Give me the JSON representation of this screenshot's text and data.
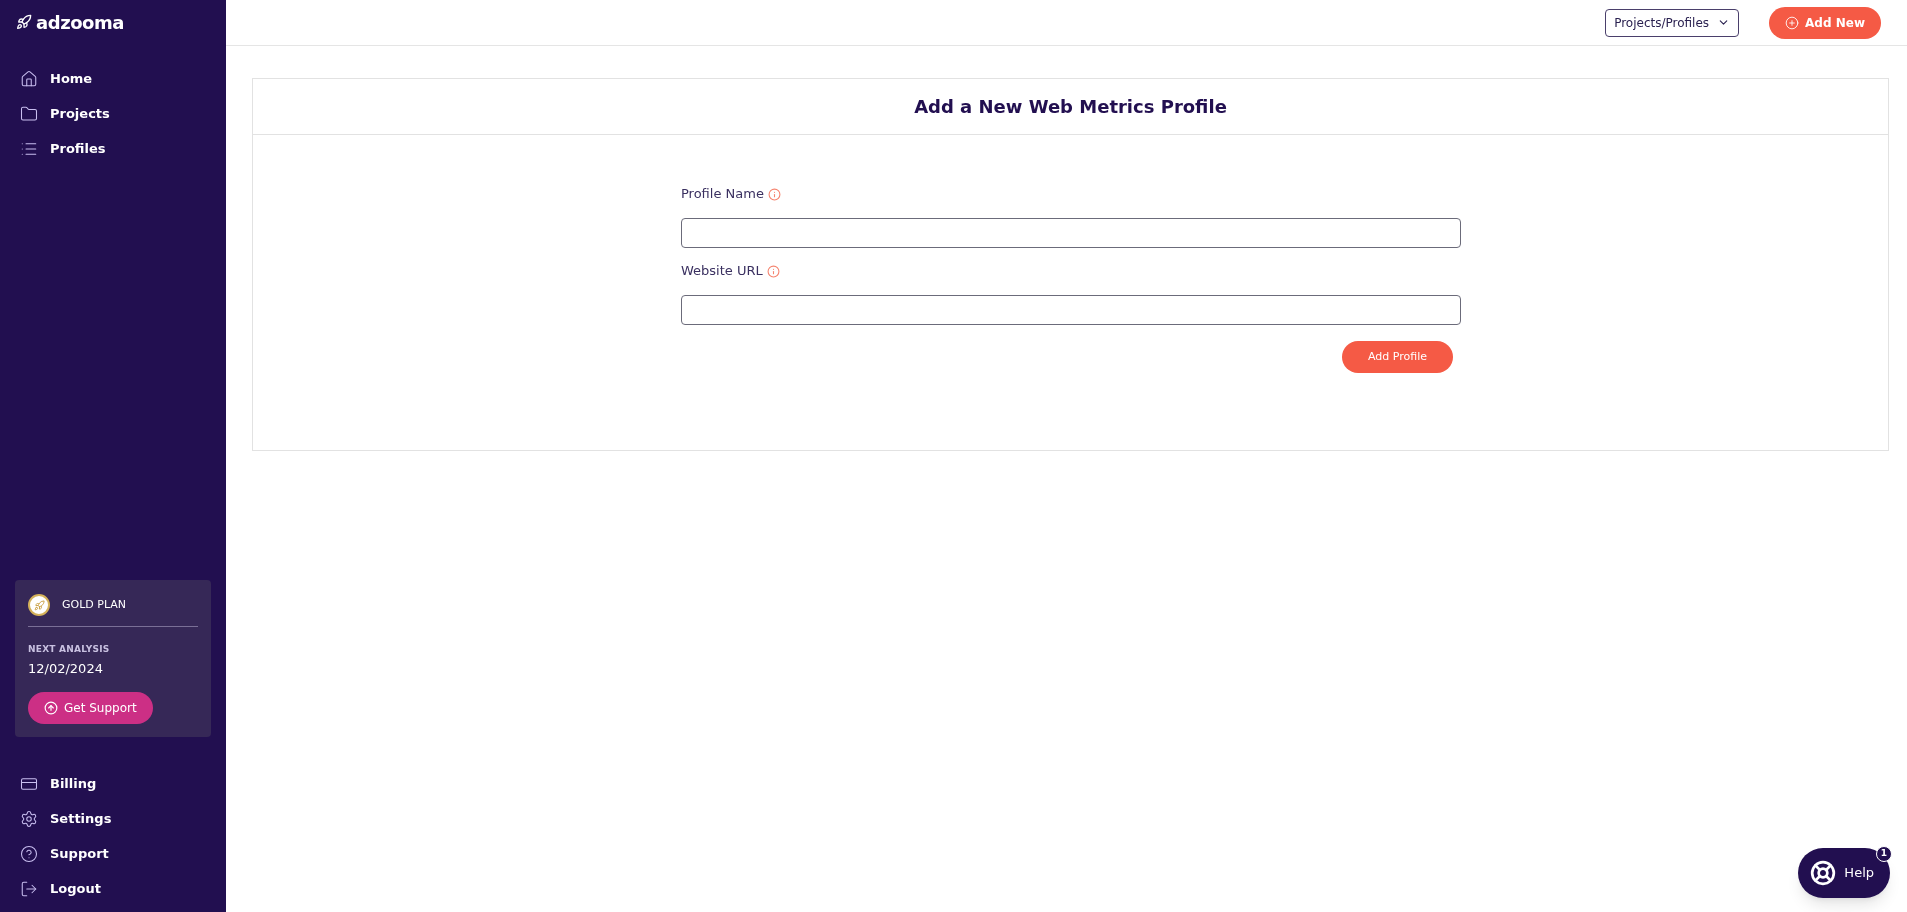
{
  "logo": "adzooma",
  "nav_top": [
    {
      "kind": "home",
      "label": "Home"
    },
    {
      "kind": "projects",
      "label": "Projects"
    },
    {
      "kind": "profiles",
      "label": "Profiles"
    }
  ],
  "plan": {
    "name": "GOLD PLAN",
    "next_label": "NEXT ANALYSIS",
    "next_date": "12/02/2024",
    "button": "Get Support"
  },
  "nav_bottom": [
    {
      "kind": "billing",
      "label": "Billing"
    },
    {
      "kind": "settings",
      "label": "Settings"
    },
    {
      "kind": "support",
      "label": "Support"
    },
    {
      "kind": "logout",
      "label": "Logout"
    }
  ],
  "header": {
    "dropdown": "Projects/Profiles",
    "add_button": "Add New"
  },
  "form": {
    "title": "Add a New Web Metrics Profile",
    "fields": [
      {
        "label": "Profile Name"
      },
      {
        "label": "Website URL"
      }
    ],
    "submit": "Add Profile"
  },
  "help": {
    "label": "Help",
    "badge": "1"
  }
}
